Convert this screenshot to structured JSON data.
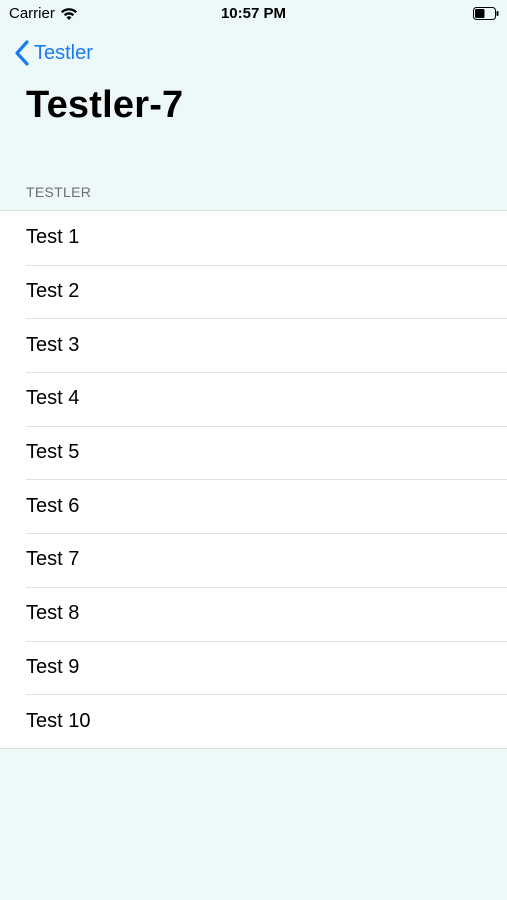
{
  "status_bar": {
    "carrier": "Carrier",
    "time": "10:57 PM",
    "battery_level": 0.5
  },
  "nav": {
    "back_label": "Testler",
    "title": "Testler-7"
  },
  "section": {
    "header": "TESTLER"
  },
  "items": [
    {
      "label": "Test 1"
    },
    {
      "label": "Test 2"
    },
    {
      "label": "Test 3"
    },
    {
      "label": "Test 4"
    },
    {
      "label": "Test 5"
    },
    {
      "label": "Test 6"
    },
    {
      "label": "Test 7"
    },
    {
      "label": "Test 8"
    },
    {
      "label": "Test 9"
    },
    {
      "label": "Test 10"
    }
  ],
  "colors": {
    "background": "#EDF9F9",
    "accent": "#1A7BF2",
    "section_header": "#6D6D72"
  }
}
